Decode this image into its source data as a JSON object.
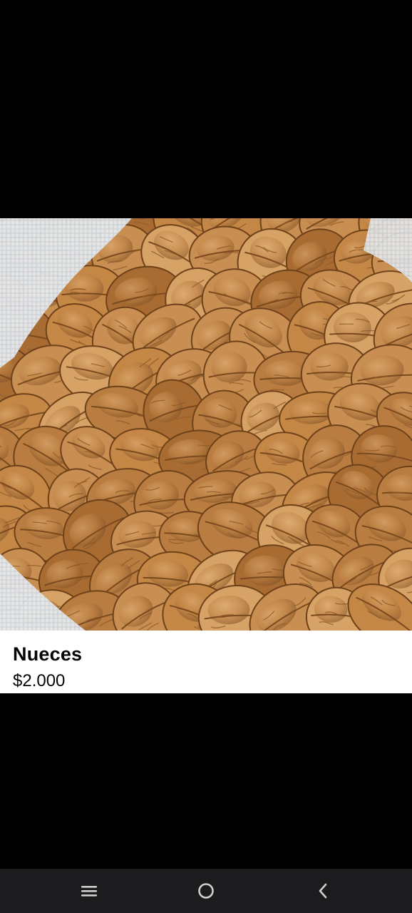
{
  "listing": {
    "title": "Nueces",
    "price": "$2.000"
  },
  "photo": {
    "subject": "walnuts-in-sack"
  },
  "navbar": {
    "recents_icon": "recents-icon",
    "home_icon": "home-icon",
    "back_icon": "back-icon"
  },
  "colors": {
    "background": "#000000",
    "navbar": "#1c1c1e",
    "card": "#ffffff",
    "text": "#050505",
    "walnut_light": "#d9a56a",
    "walnut_mid": "#b87a3f",
    "walnut_dark": "#8a5526",
    "sack": "#e8ecef"
  }
}
